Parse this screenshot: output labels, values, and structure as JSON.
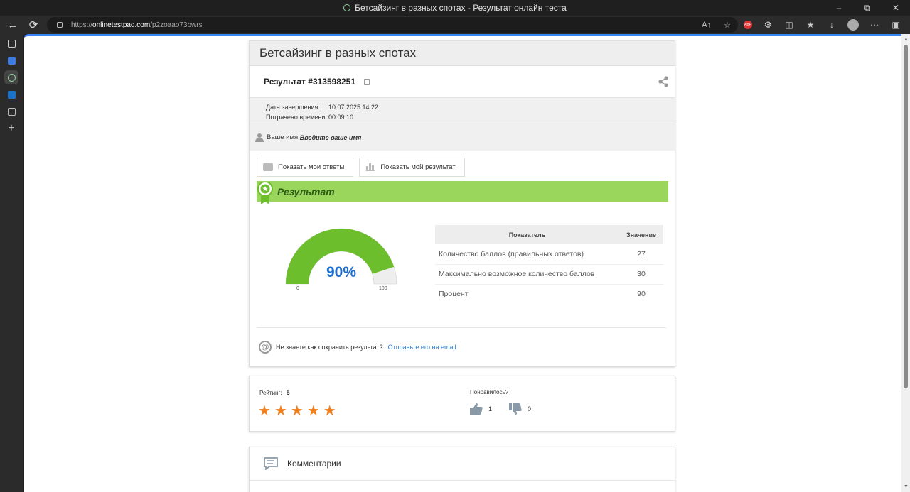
{
  "browser": {
    "window_title": "Бетсайзинг в разных спотах - Результат онлайн теста",
    "url_prefix": "https://",
    "url_host": "onlinetestpad.com",
    "url_path": "/p2zoaao73bwrs",
    "abp_label": "ABP"
  },
  "sidebar": {
    "items": [
      "tabs-icon",
      "notes-icon",
      "copilot-icon",
      "outlook-icon",
      "wallet-icon",
      "add-icon"
    ]
  },
  "page": {
    "test_title": "Бетсайзинг в разных спотах",
    "result_title": "Результат #313598251",
    "meta": {
      "completed_label": "Дата завершения:",
      "completed_value": "10.07.2025 14:22",
      "time_label": "Потрачено времени:",
      "time_value": "00:09:10"
    },
    "user": {
      "label": "Ваше имя:",
      "placeholder": "Введите ваше имя"
    },
    "buttons": {
      "show_answers": "Показать мои ответы",
      "show_result": "Показать мой результат"
    },
    "result_banner": "Результат",
    "gauge": {
      "value": 90,
      "display": "90%",
      "min_label": "0",
      "max_label": "100",
      "fill_color": "#6cbe2d",
      "track_color": "#eeeeee"
    },
    "table": {
      "headers": [
        "Показатель",
        "Значение"
      ],
      "rows": [
        {
          "k": "Количество баллов (правильных ответов)",
          "v": "27"
        },
        {
          "k": "Максимально возможное количество баллов",
          "v": "30"
        },
        {
          "k": "Процент",
          "v": "90"
        }
      ]
    },
    "save": {
      "question": "Не знаете как сохранить результат?",
      "link": "Отправьте его на email"
    },
    "rating": {
      "label": "Рейтинг:",
      "value": "5",
      "stars": 5,
      "liked_label": "Понравилось?",
      "likes": "1",
      "dislikes": "0"
    },
    "comments": {
      "title": "Комментарии"
    }
  },
  "colors": {
    "accent": "#3b82f6",
    "banner": "#9bd65c",
    "star": "#f07f1e",
    "link": "#2a7bd2",
    "gauge_text": "#1d6fd1"
  }
}
